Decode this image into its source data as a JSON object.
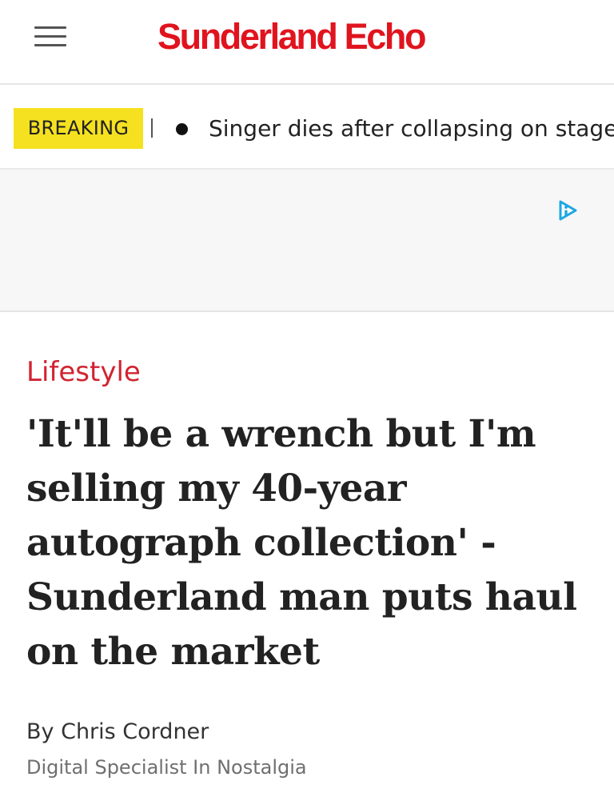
{
  "header": {
    "logo_text": "Sunderland Echo",
    "menu_icon": "hamburger-menu-icon",
    "brand_color": "#e0141e"
  },
  "breaking": {
    "label": "BREAKING",
    "headline": "Singer dies after collapsing on stage",
    "label_background": "#f5e11f"
  },
  "ad": {
    "icon": "adchoices-icon"
  },
  "article": {
    "category": "Lifestyle",
    "category_color": "#d22331",
    "headline": "'It'll be a wrench but I'm selling my 40-year autograph collection' - Sunderland man puts haul on the market",
    "byline_prefix": "By ",
    "author": "Chris Cordner",
    "author_role": "Digital Specialist In Nostalgia"
  }
}
